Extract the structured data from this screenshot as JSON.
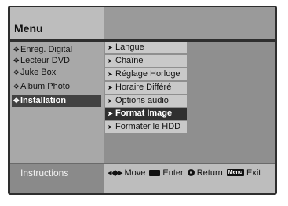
{
  "menu": {
    "title": "Menu",
    "items": [
      {
        "label": "Enreg. Digital",
        "selected": false
      },
      {
        "label": "Lecteur DVD",
        "selected": false
      },
      {
        "label": "Juke Box",
        "selected": false
      },
      {
        "label": "Album Photo",
        "selected": false
      },
      {
        "label": "Installation",
        "selected": true
      }
    ]
  },
  "submenu": {
    "items": [
      {
        "label": "Langue",
        "selected": false
      },
      {
        "label": "Chaîne",
        "selected": false
      },
      {
        "label": "Réglage Horloge",
        "selected": false
      },
      {
        "label": "Horaire Différé",
        "selected": false
      },
      {
        "label": "Options audio",
        "selected": false
      },
      {
        "label": "Format Image",
        "selected": true
      },
      {
        "label": "Formater le HDD",
        "selected": false
      }
    ]
  },
  "instructions": {
    "label": "Instructions",
    "move": "Move",
    "enter": "Enter",
    "return": "Return",
    "menu_key": "Menu",
    "exit": "Exit"
  },
  "icons": {
    "menu_bullet": "diamond-dot-icon",
    "submenu_arrow": "right-arrow-icon",
    "move": "four-way-arrows-icon",
    "enter": "enter-key-icon",
    "return": "return-circle-icon"
  },
  "colors": {
    "selected_bg": "#2f2f2f",
    "selected_text": "#ffffff",
    "panel_light": "#c9c9c9",
    "frame": "#2e2e2e"
  }
}
